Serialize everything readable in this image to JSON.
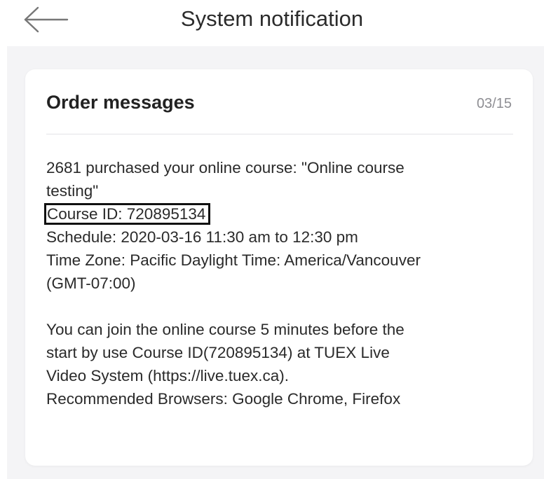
{
  "header": {
    "title": "System notification",
    "back_icon": "arrow-left-icon"
  },
  "card": {
    "title": "Order messages",
    "date": "03/15",
    "lines": {
      "l1": "2681 purchased your online course: \"Online course",
      "l2": "testing\"",
      "course_id": "Course ID: 720895134",
      "schedule": "Schedule: 2020-03-16 11:30 am to 12:30 pm",
      "tz1": "Time Zone: Pacific Daylight Time: America/Vancouver",
      "tz2": "(GMT-07:00)",
      "join1": "You can join the online course 5 minutes before the",
      "join2": "start by use Course ID(720895134) at TUEX Live",
      "join3": "Video System (https://live.tuex.ca).",
      "browsers": "Recommended Browsers: Google Chrome, Firefox"
    }
  },
  "colors": {
    "background": "#f4f4f6",
    "card": "#ffffff",
    "date_text": "#8e8e93",
    "highlight_border": "#111111"
  }
}
